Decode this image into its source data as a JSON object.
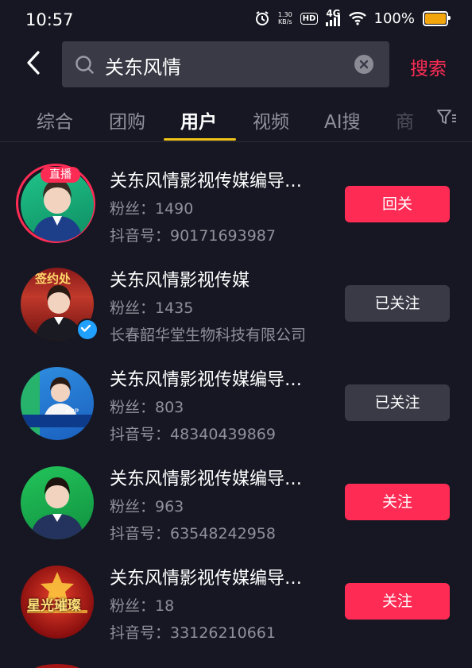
{
  "status_bar": {
    "time": "10:57",
    "speed_value": "1.30",
    "speed_unit": "KB/s",
    "hd": "HD",
    "network": "4G",
    "battery": "100%"
  },
  "search": {
    "query": "关东风情",
    "submit_label": "搜索"
  },
  "tabs": [
    {
      "label": "综合"
    },
    {
      "label": "团购"
    },
    {
      "label": "用户"
    },
    {
      "label": "视频"
    },
    {
      "label": "AI搜"
    },
    {
      "label": "商"
    }
  ],
  "active_tab": "用户",
  "users": [
    {
      "name": "关东风情影视传媒编导…",
      "fans": "粉丝：1490",
      "sub": "抖音号：90171693987",
      "button": "回关",
      "live": "直播",
      "verified": false
    },
    {
      "name": "关东风情影视传媒",
      "fans": "粉丝：1435",
      "sub": "长春韶华堂生物科技有限公司",
      "button": "已关注",
      "verified": true
    },
    {
      "name": "关东风情影视传媒编导…",
      "fans": "粉丝：803",
      "sub": "抖音号：48340439869",
      "button": "已关注",
      "verified": false
    },
    {
      "name": "关东风情影视传媒编导…",
      "fans": "粉丝：963",
      "sub": "抖音号：63548242958",
      "button": "关注",
      "verified": false
    },
    {
      "name": "关东风情影视传媒编导…",
      "fans": "粉丝：18",
      "sub": "抖音号：33126210661",
      "button": "关注",
      "verified": false
    }
  ],
  "avatar_signs": {
    "row2": "签约处",
    "row3": "APP",
    "row5": "星光璀璨"
  },
  "colors": {
    "accent": "#fe2c55",
    "tab_underline": "#f2c418",
    "background": "#161722",
    "secondary_button": "#393a46",
    "verified": "#20a0ff"
  }
}
